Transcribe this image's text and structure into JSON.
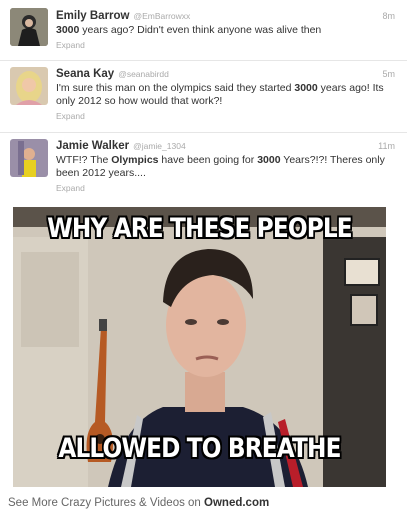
{
  "tweets": [
    {
      "name": "Emily Barrow",
      "handle": "@EmBarrowxx",
      "time": "8m",
      "text_parts": [
        "",
        "3000",
        " years ago? Didn't even think anyone was alive then"
      ],
      "expand": "Expand"
    },
    {
      "name": "Seana Kay",
      "handle": "@seanabirdd",
      "time": "5m",
      "text_parts": [
        "I'm sure this man on the olympics said they started ",
        "3000",
        " years ago! Its only 2012 so how would that work?!"
      ],
      "expand": "Expand"
    },
    {
      "name": "Jamie Walker",
      "handle": "@jamie_1304",
      "time": "11m",
      "text_parts": [
        "WTF!? The ",
        "Olympics",
        " have been going for ",
        "3000",
        " Years?!?! Theres only been 2012 years...."
      ],
      "expand": "Expand"
    }
  ],
  "meme": {
    "top_text": "WHY ARE THESE PEOPLE",
    "bottom_text": "ALLOWED TO BREATHE"
  },
  "footer": {
    "prefix": "See More Crazy Pictures & Videos on ",
    "brand": "Owned.com"
  },
  "colors": {
    "text": "#333333",
    "muted": "#aaaaaa",
    "meme_bg": "#000000",
    "caption": "#ffffff"
  }
}
